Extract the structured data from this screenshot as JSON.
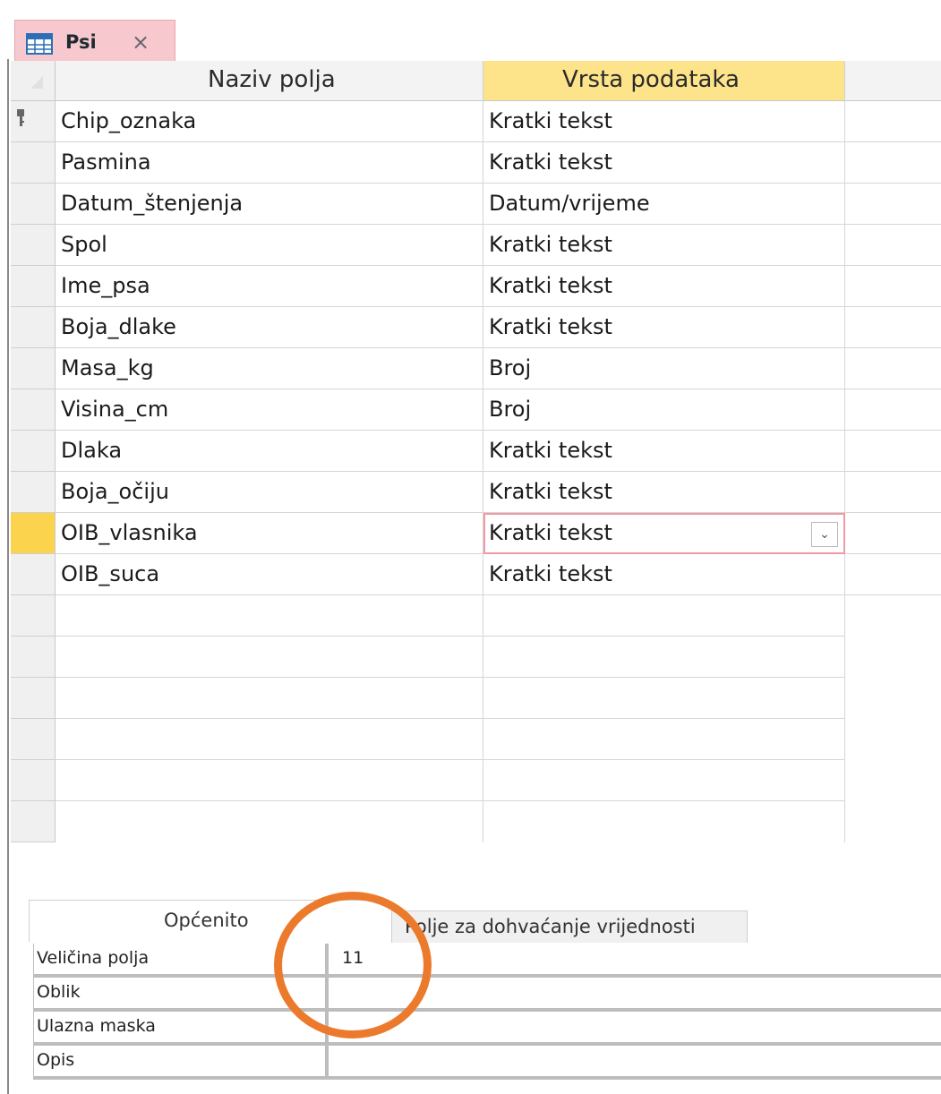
{
  "tab": {
    "icon": "table-icon",
    "label": "Psi",
    "close_icon": "close-icon"
  },
  "grid": {
    "headers": {
      "field_name": "Naziv polja",
      "data_type": "Vrsta podataka"
    },
    "rows": [
      {
        "name": "Chip_oznaka",
        "type": "Kratki tekst",
        "primary_key": true
      },
      {
        "name": "Pasmina",
        "type": "Kratki tekst"
      },
      {
        "name": "Datum_štenjenja",
        "type": "Datum/vrijeme"
      },
      {
        "name": "Spol",
        "type": "Kratki tekst"
      },
      {
        "name": "Ime_psa",
        "type": "Kratki tekst"
      },
      {
        "name": "Boja_dlake",
        "type": "Kratki tekst"
      },
      {
        "name": "Masa_kg",
        "type": "Broj"
      },
      {
        "name": "Visina_cm",
        "type": "Broj"
      },
      {
        "name": "Dlaka",
        "type": "Kratki tekst"
      },
      {
        "name": "Boja_očiju",
        "type": "Kratki tekst"
      },
      {
        "name": "OIB_vlasnika",
        "type": "Kratki tekst",
        "current": true
      },
      {
        "name": "OIB_suca",
        "type": "Kratki tekst"
      }
    ]
  },
  "properties": {
    "tabs": {
      "general": "Općenito",
      "lookup": "Polje za dohvaćanje vrijednosti"
    },
    "rows": [
      {
        "label": "Veličina polja",
        "value": "11"
      },
      {
        "label": "Oblik",
        "value": ""
      },
      {
        "label": "Ulazna maska",
        "value": ""
      },
      {
        "label": "Opis",
        "value": ""
      }
    ]
  },
  "colors": {
    "active_header": "#fde48a",
    "current_row": "#fcd34d",
    "tab": "#f7c8cd",
    "highlight_circle": "#ec7a2c"
  }
}
